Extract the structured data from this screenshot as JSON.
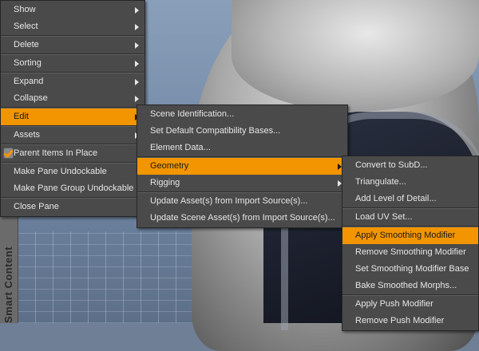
{
  "left_panel": {
    "label": "Smart Content"
  },
  "menu_main": {
    "items": [
      {
        "label": "Show",
        "submenu": true
      },
      {
        "label": "Select",
        "submenu": true
      },
      {
        "label": "Delete",
        "submenu": true
      },
      {
        "label": "Sorting",
        "submenu": true
      },
      {
        "label": "Expand",
        "submenu": true
      },
      {
        "label": "Collapse",
        "submenu": true
      },
      {
        "label": "Edit",
        "submenu": true,
        "active": true
      },
      {
        "label": "Assets",
        "submenu": true
      },
      {
        "label": "Parent Items In Place",
        "checked": true
      },
      {
        "label": "Make Pane Undockable"
      },
      {
        "label": "Make Pane Group Undockable"
      },
      {
        "label": "Close Pane"
      }
    ]
  },
  "menu_edit": {
    "items": [
      {
        "label": "Scene Identification..."
      },
      {
        "label": "Set Default Compatibility Bases..."
      },
      {
        "label": "Element Data..."
      },
      {
        "label": "Geometry",
        "submenu": true,
        "active": true
      },
      {
        "label": "Rigging",
        "submenu": true
      },
      {
        "label": "Update Asset(s) from Import Source(s)..."
      },
      {
        "label": "Update Scene Asset(s) from Import Source(s)..."
      }
    ]
  },
  "menu_geometry": {
    "items": [
      {
        "label": "Convert to SubD..."
      },
      {
        "label": "Triangulate..."
      },
      {
        "label": "Add Level of Detail..."
      },
      {
        "label": "Load UV Set..."
      },
      {
        "label": "Apply Smoothing Modifier",
        "active": true
      },
      {
        "label": "Remove Smoothing Modifier"
      },
      {
        "label": "Set Smoothing Modifier Base"
      },
      {
        "label": "Bake Smoothed Morphs..."
      },
      {
        "label": "Apply Push Modifier"
      },
      {
        "label": "Remove Push Modifier"
      }
    ]
  },
  "colors": {
    "highlight": "#f29500",
    "menu_bg": "#4a4a4a",
    "text": "#e6e6e6"
  }
}
